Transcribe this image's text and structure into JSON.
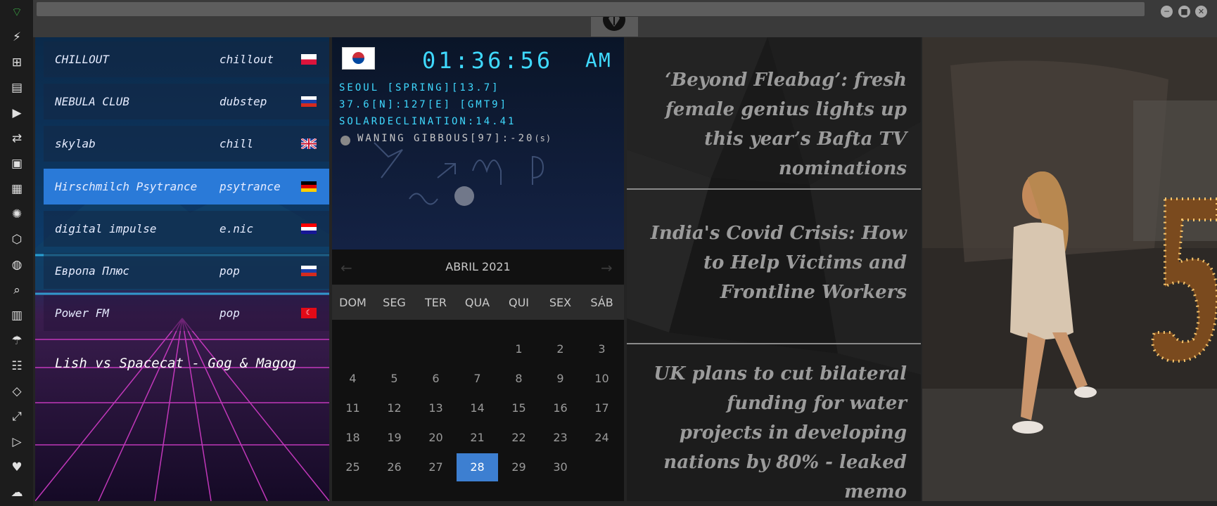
{
  "sidebar": {
    "icons": [
      "wifi-icon",
      "flash-icon",
      "windows-icon",
      "archive-icon",
      "play-icon",
      "translate-icon",
      "image-icon",
      "newspaper-icon",
      "compass-icon",
      "hexagon-icon",
      "globe-icon",
      "search-icon",
      "map-icon",
      "umbrella-icon",
      "contacts-icon",
      "code-icon",
      "expand-icon",
      "youtube-icon",
      "heart-icon",
      "cloud-icon"
    ]
  },
  "radio": {
    "stations": [
      {
        "name": "CHILLOUT",
        "genre": "chillout",
        "flag": "poland-flag"
      },
      {
        "name": "NEBULA CLUB",
        "genre": "dubstep",
        "flag": "russia-flag"
      },
      {
        "name": "skylab",
        "genre": "chill",
        "flag": "uk-flag"
      },
      {
        "name": "Hirschmilch Psytrance",
        "genre": "psytrance",
        "flag": "germany-flag"
      },
      {
        "name": "digital impulse",
        "genre": "e.nic",
        "flag": "croatia-flag"
      },
      {
        "name": "Европа Плюс",
        "genre": "pop",
        "flag": "russia-flag"
      },
      {
        "name": "Power FM",
        "genre": "pop",
        "flag": "turkey-flag"
      }
    ],
    "now_playing": "Lish vs Spacecat - Gog & Magog"
  },
  "clock": {
    "time": "01:36:56",
    "ampm": "AM",
    "line1": "SEOUL [SPRING][13.7]",
    "line2": "37.6[N]:127[E] [GMT9]",
    "line3": "SOLARDECLINATION:14.41",
    "line4": "WANING GIBBOUS[97]:-20",
    "line4_suffix": "(s)"
  },
  "calendar": {
    "month": "ABRIL 2021",
    "days_of_week": [
      "DOM",
      "SEG",
      "TER",
      "QUA",
      "QUI",
      "SEX",
      "SÁB"
    ],
    "selected_day": "28"
  },
  "news": {
    "headlines": [
      "‘Beyond Fleabag’: fresh female genius lights up this year’s Bafta TV nominations",
      "India's Covid Crisis: How to Help Victims and Frontline Workers",
      "UK plans to cut bilateral funding for water projects in developing nations by 80% - leaked memo"
    ]
  },
  "colors": {
    "accent": "#3fd9ff",
    "selected_day_bg": "#3d7fd1",
    "selected_station_bg": "#2a7ad8"
  }
}
